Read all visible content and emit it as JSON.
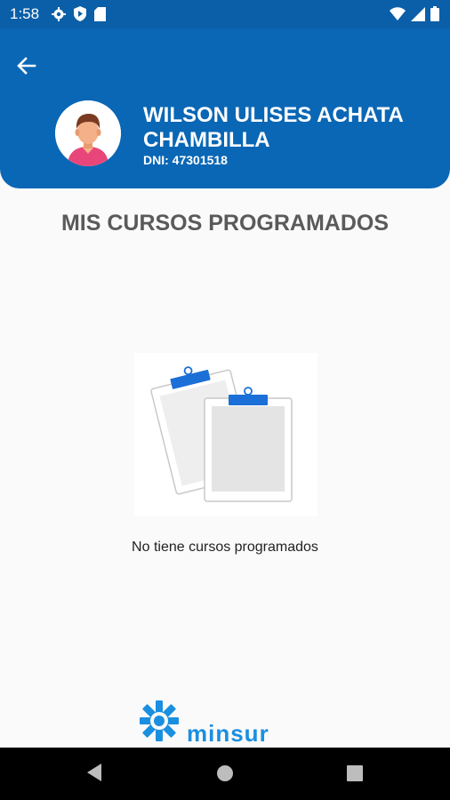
{
  "status_bar": {
    "time": "1:58",
    "left_icons": [
      "gear-icon",
      "shield-play-icon",
      "sd-card-icon"
    ],
    "right_icons": [
      "wifi-icon",
      "signal-icon",
      "battery-icon"
    ]
  },
  "header": {
    "back_icon": "arrow-left-icon",
    "user_name": "WILSON ULISES ACHATA CHAMBILLA",
    "dni_label": "DNI:",
    "dni_value": "47301518",
    "color": "#0a67b5"
  },
  "main": {
    "title": "MIS CURSOS PROGRAMADOS",
    "empty_message": "No tiene cursos programados",
    "illustration": "clipboards-empty-illustration"
  },
  "footer": {
    "brand_name": "minsur",
    "brand_color": "#1a8fe0"
  },
  "nav_bar": {
    "buttons": [
      "back-triangle-icon",
      "home-circle-icon",
      "recents-square-icon"
    ]
  }
}
